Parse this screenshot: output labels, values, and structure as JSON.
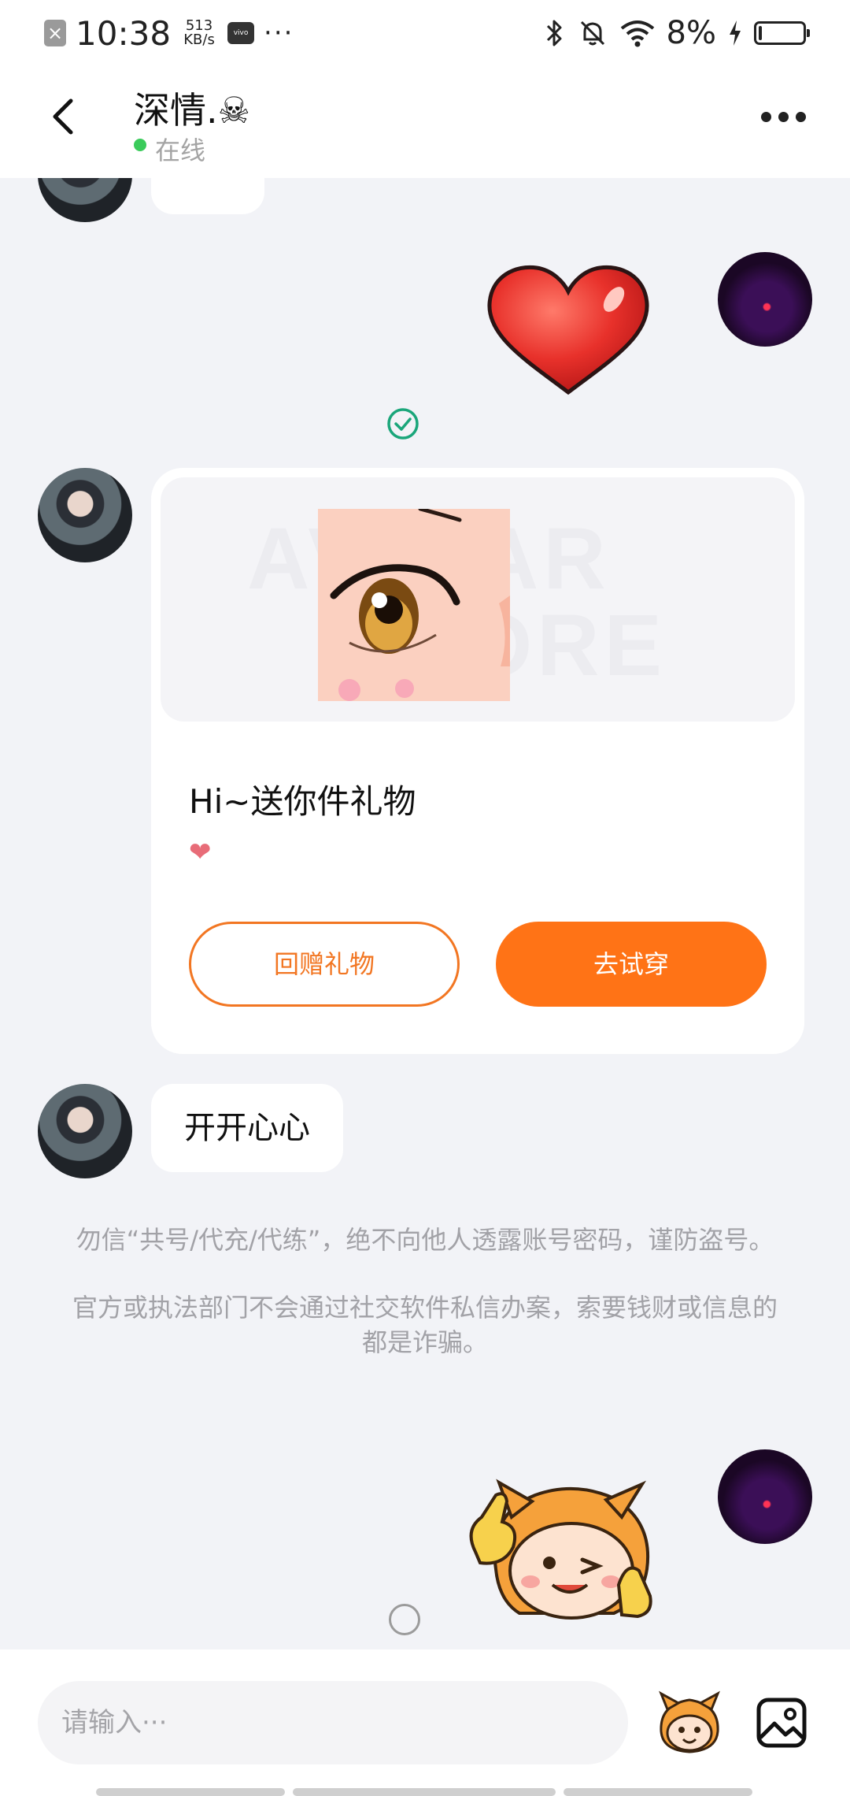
{
  "status_bar": {
    "time": "10:38",
    "speed": "513 KB/s",
    "carrier_icon": "vivo",
    "more": "···",
    "battery": "8%",
    "battery_level": 0.08
  },
  "header": {
    "contact_name": "深情.☠",
    "status": "在线"
  },
  "chat": {
    "gift_card": {
      "title": "Hi~送你件礼物",
      "heart": "❤",
      "watermark_line1": "AVATAR",
      "watermark_line2": "STORE",
      "return_gift_label": "回赠礼物",
      "try_on_label": "去试穿"
    },
    "message_text": "开开心心",
    "system_notice": {
      "line1": "勿信“共号/代充/代练”，绝不向他人透露账号密码，谨防盗号。",
      "line2": "官方或执法部门不会通过社交软件私信办案，索要钱财或信息的都是诈骗。"
    }
  },
  "input_bar": {
    "placeholder": "请输入···"
  },
  "colors": {
    "accent": "#ff7316",
    "online": "#3bcb5b",
    "read_check": "#1aa67a"
  }
}
